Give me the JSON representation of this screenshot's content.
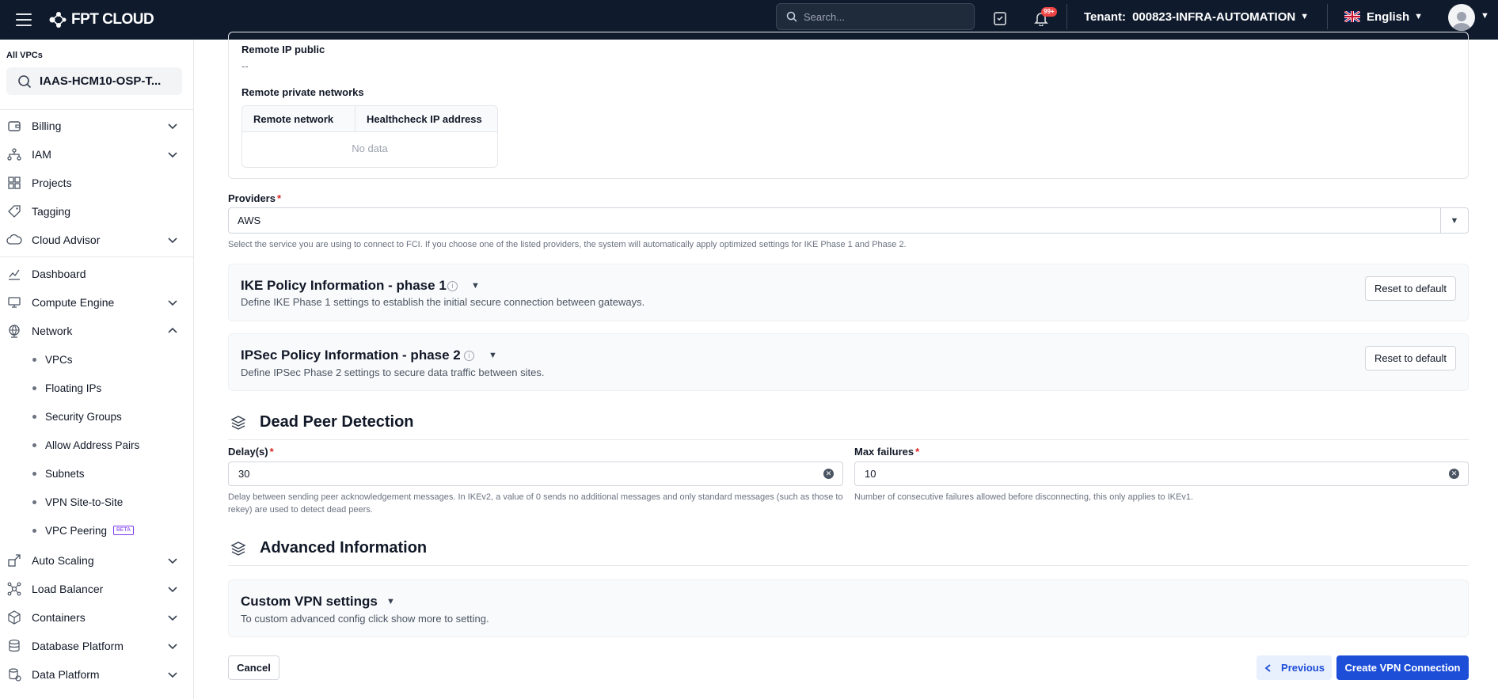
{
  "topbar": {
    "brand": "FPT CLOUD",
    "search_placeholder": "Search...",
    "notif_badge": "99+",
    "tenant_label": "Tenant:",
    "tenant_value": "000823-INFRA-AUTOMATION",
    "language": "English"
  },
  "sidebar": {
    "all_vpcs": "All VPCs",
    "vpc_selected": "IAAS-HCM10-OSP-T...",
    "items": [
      {
        "label": "Billing"
      },
      {
        "label": "IAM"
      },
      {
        "label": "Projects"
      },
      {
        "label": "Tagging"
      },
      {
        "label": "Cloud Advisor"
      },
      {
        "label": "Dashboard"
      },
      {
        "label": "Compute Engine"
      },
      {
        "label": "Network"
      },
      {
        "label": "Auto Scaling"
      },
      {
        "label": "Load Balancer"
      },
      {
        "label": "Containers"
      },
      {
        "label": "Database Platform"
      },
      {
        "label": "Data Platform"
      }
    ],
    "network_sub": [
      {
        "label": "VPCs"
      },
      {
        "label": "Floating IPs"
      },
      {
        "label": "Security Groups"
      },
      {
        "label": "Allow Address Pairs"
      },
      {
        "label": "Subnets"
      },
      {
        "label": "VPN Site-to-Site"
      },
      {
        "label": "VPC Peering",
        "badge": "BETA"
      }
    ]
  },
  "remote": {
    "ip_public_label": "Remote IP public",
    "ip_public_value": "--",
    "private_networks_label": "Remote private networks",
    "table_headers": [
      "Remote network",
      "Healthcheck IP address"
    ],
    "empty_text": "No data"
  },
  "providers": {
    "label": "Providers",
    "required": "*",
    "value": "AWS",
    "hint": "Select the service you are using to connect to FCI. If you choose one of the listed providers, the system will automatically apply optimized settings for IKE Phase 1 and Phase 2."
  },
  "ike": {
    "title": "IKE Policy Information - phase 1",
    "desc": "Define IKE Phase 1 settings to establish the initial secure connection between gateways.",
    "reset": "Reset to default"
  },
  "ipsec": {
    "title": "IPSec Policy Information - phase 2",
    "desc": "Define IPSec Phase 2 settings to secure data traffic between sites.",
    "reset": "Reset to default"
  },
  "dpd": {
    "title": "Dead Peer Detection",
    "delay_label": "Delay(s)",
    "delay_value": "30",
    "delay_hint": "Delay between sending peer acknowledgement messages. In IKEv2, a value of 0 sends no additional messages and only standard messages (such as those to rekey) are used to detect dead peers.",
    "max_label": "Max failures",
    "max_value": "10",
    "max_hint": "Number of consecutive failures allowed before disconnecting, this only applies to IKEv1."
  },
  "advanced": {
    "title": "Advanced Information",
    "custom_title": "Custom VPN settings",
    "custom_desc": "To custom advanced config click show more to setting."
  },
  "footer": {
    "cancel": "Cancel",
    "previous": "Previous",
    "create": "Create VPN Connection"
  },
  "colors": {
    "topbar_bg": "#0f1b2d",
    "primary": "#1d4ed8",
    "required": "#dc2626"
  }
}
